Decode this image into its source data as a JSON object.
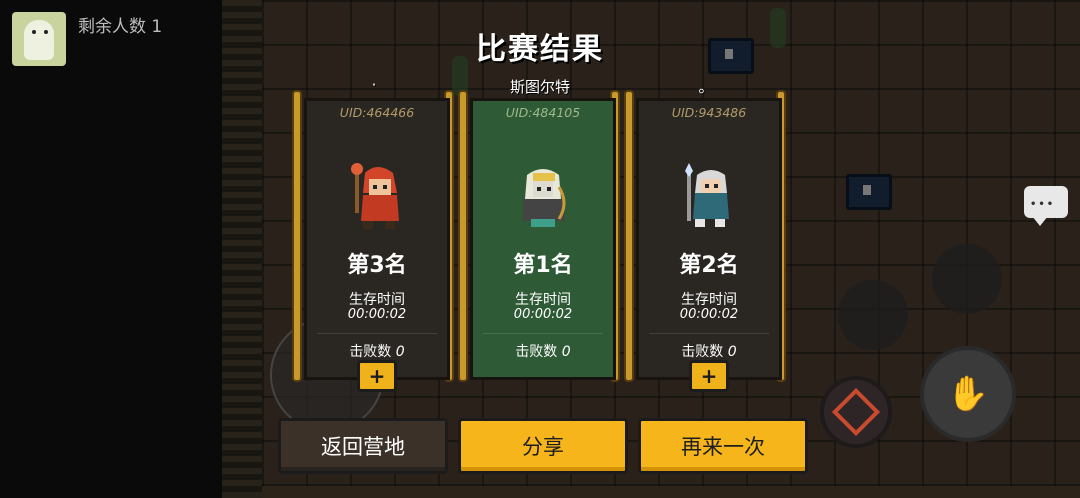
{
  "hud": {
    "remaining_label": "剩余人数 1"
  },
  "results": {
    "title": "比赛结果",
    "survival_label": "生存时间",
    "kills_label": "击败数",
    "add_symbol": "+",
    "players": [
      {
        "name": "·",
        "uid": "UID:464466",
        "rank": "第3名",
        "survival_time": "00:00:02",
        "kills": "0",
        "winner": false
      },
      {
        "name": "斯图尔特",
        "uid": "UID:484105",
        "rank": "第1名",
        "survival_time": "00:00:02",
        "kills": "0",
        "winner": true
      },
      {
        "name": "。",
        "uid": "UID:943486",
        "rank": "第2名",
        "survival_time": "00:00:02",
        "kills": "0",
        "winner": false
      }
    ]
  },
  "buttons": {
    "back_to_camp": "返回营地",
    "share": "分享",
    "play_again": "再来一次"
  },
  "colors": {
    "winner_card": "#2f5a36",
    "card": "#2a2622",
    "gold": "#f5b51b",
    "frame": "#c89a2b"
  },
  "icons": {
    "chat": "chat-bubble-icon",
    "interact": "hand-icon",
    "skill": "skill-diamond-icon"
  }
}
